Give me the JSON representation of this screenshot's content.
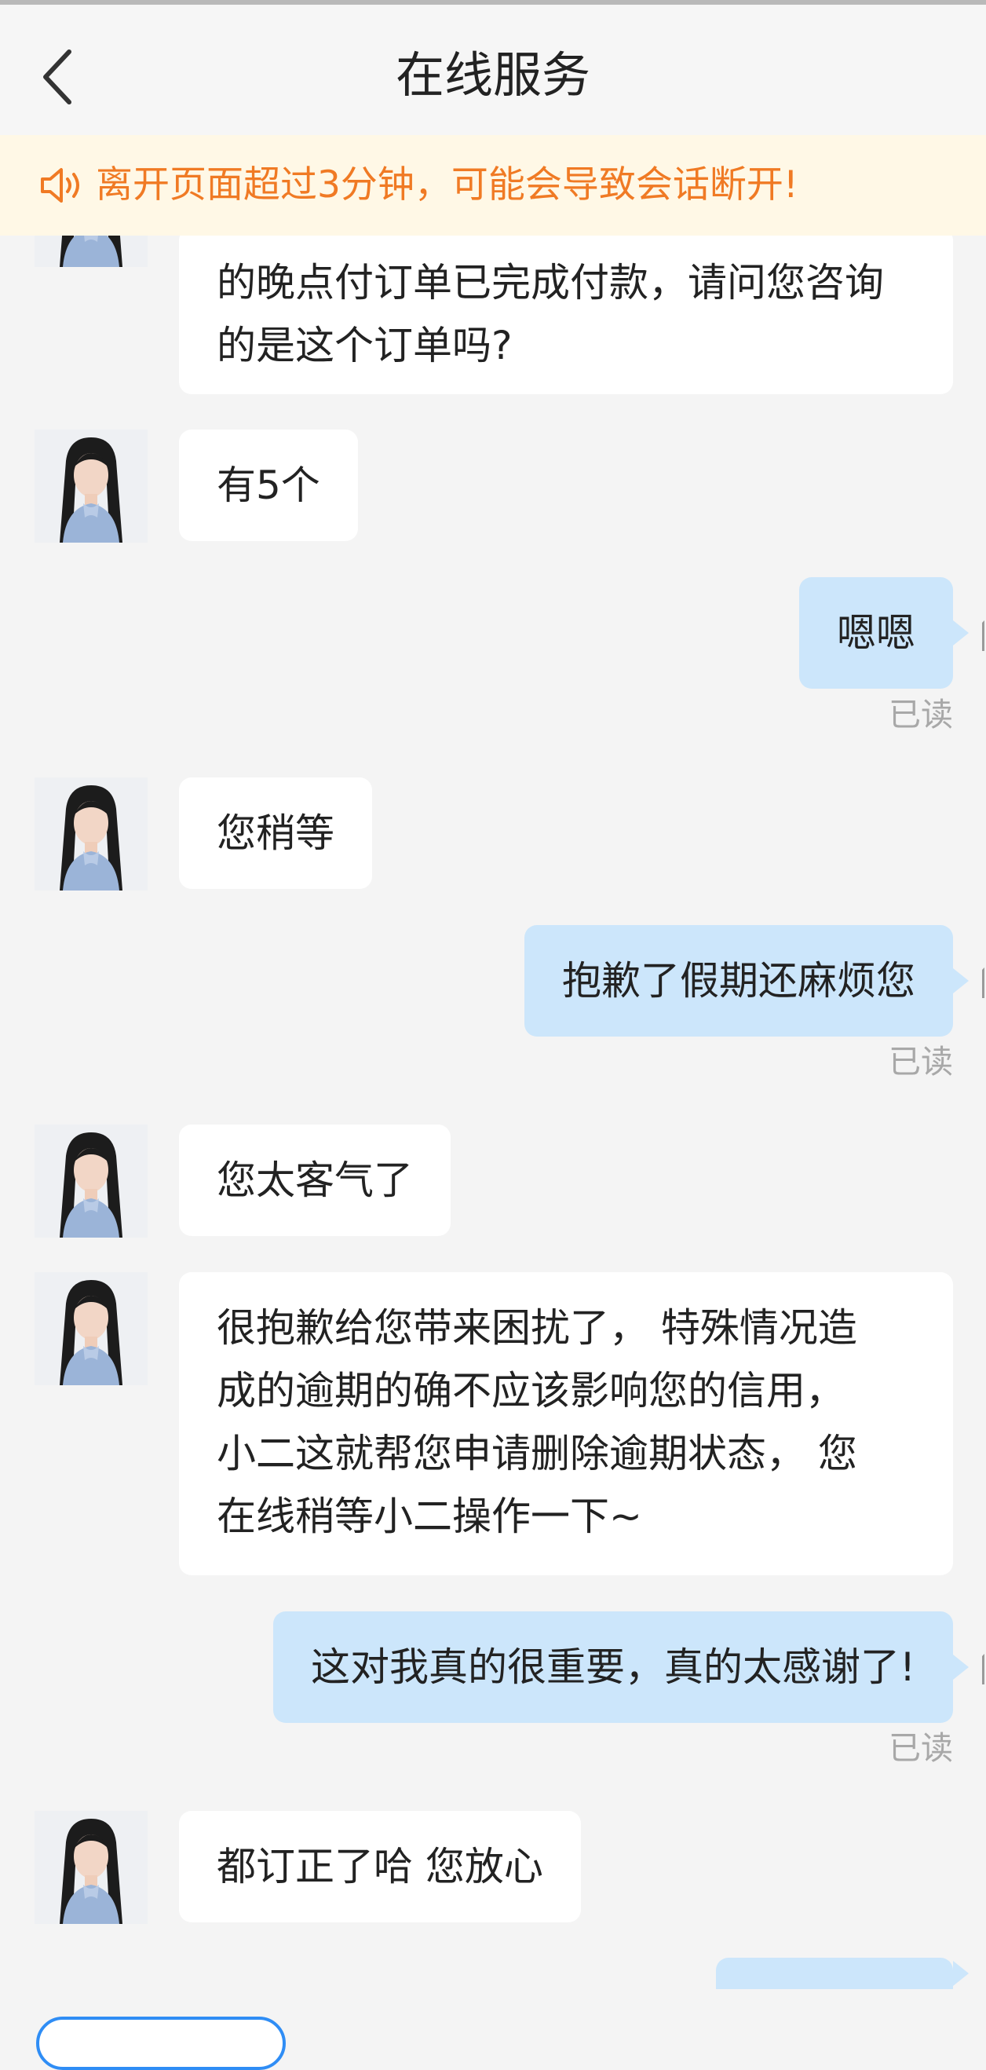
{
  "header": {
    "title": "在线服务",
    "back_icon": "chevron-left-icon"
  },
  "notice": {
    "icon": "speaker-icon",
    "text": "离开页面超过3分钟，可能会导致会话断开!"
  },
  "messages": [
    {
      "from": "agent",
      "lines": [
        "的晚点付订单已完成付款，请问您咨询",
        "的是这个订单吗?"
      ]
    },
    {
      "from": "agent",
      "lines": [
        "有5个"
      ]
    },
    {
      "from": "user",
      "lines": [
        "嗯嗯"
      ],
      "status": "已读"
    },
    {
      "from": "agent",
      "lines": [
        "您稍等"
      ]
    },
    {
      "from": "user",
      "lines": [
        "抱歉了假期还麻烦您"
      ],
      "status": "已读"
    },
    {
      "from": "agent",
      "lines": [
        "您太客气了"
      ]
    },
    {
      "from": "agent",
      "lines": [
        "很抱歉给您带来困扰了， 特殊情况造",
        "成的逾期的确不应该影响您的信用，",
        "小二这就帮您申请删除逾期状态， 您",
        "在线稍等小二操作一下~"
      ]
    },
    {
      "from": "user",
      "lines": [
        "这对我真的很重要，真的太感谢了!"
      ],
      "status": "已读"
    },
    {
      "from": "agent",
      "lines": [
        "都订正了哈 您放心"
      ]
    },
    {
      "from": "user",
      "lines": [
        ""
      ]
    }
  ],
  "colors": {
    "accent": "#2f8df5",
    "notice_text": "#f07a24",
    "notice_bg": "#fff8e6",
    "user_bubble": "#cce6fb",
    "agent_bubble": "#ffffff"
  }
}
